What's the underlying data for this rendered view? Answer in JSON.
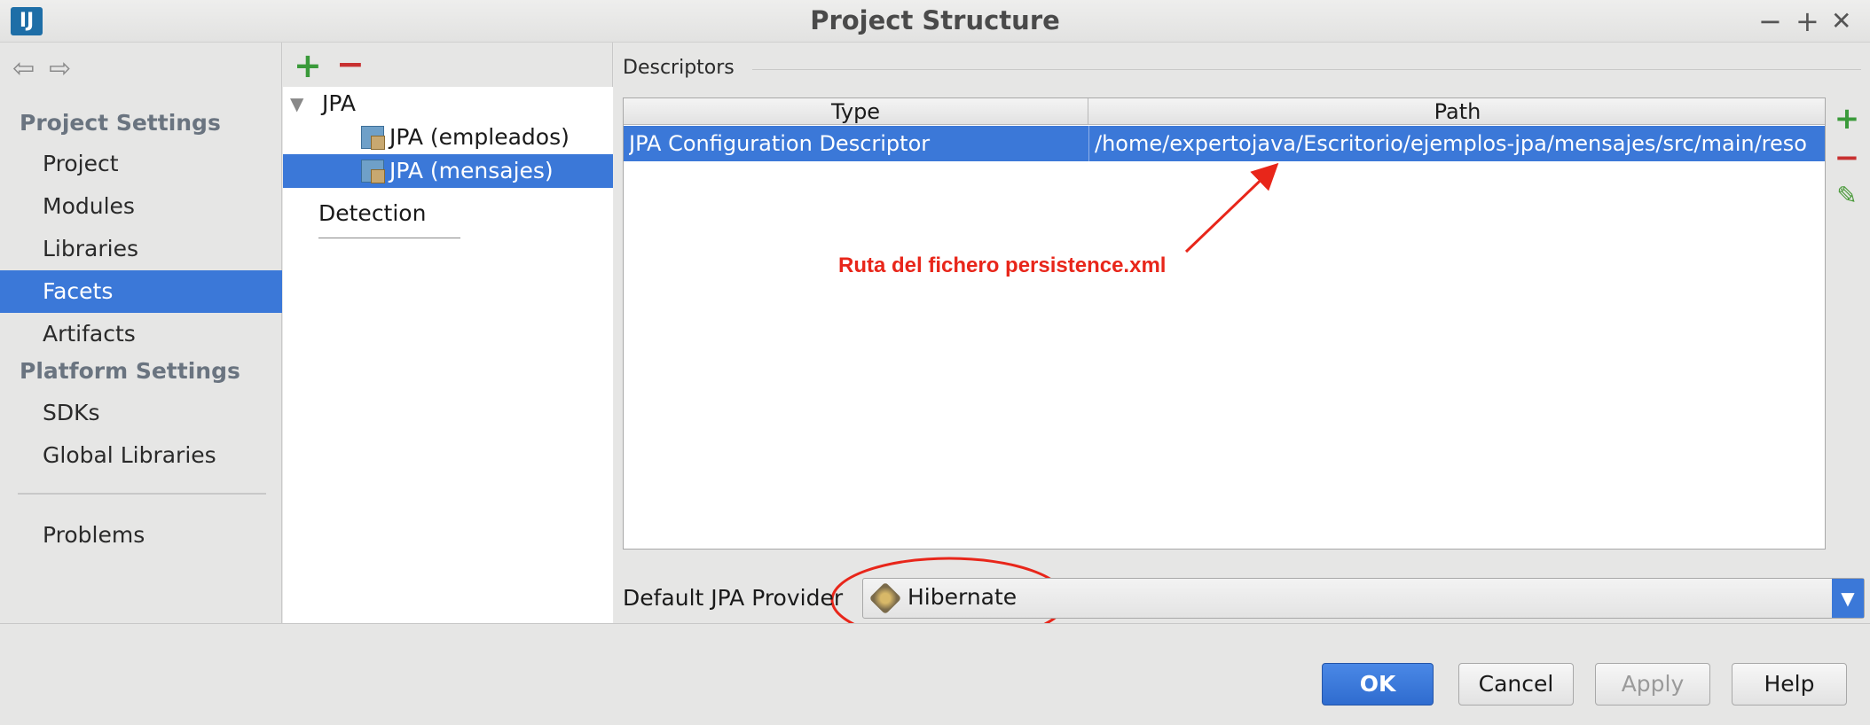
{
  "window": {
    "title": "Project Structure",
    "logo": "IJ",
    "minimize": "−",
    "maximize": "+",
    "close": "✕"
  },
  "nav": {
    "back": "⇦",
    "forward": "⇨",
    "project_settings_heading": "Project Settings",
    "project_items": [
      "Project",
      "Modules",
      "Libraries",
      "Facets",
      "Artifacts"
    ],
    "platform_settings_heading": "Platform Settings",
    "platform_items": [
      "SDKs",
      "Global Libraries"
    ],
    "problems": "Problems",
    "selected": "Facets"
  },
  "tree": {
    "add": "+",
    "remove": "−",
    "root": "JPA",
    "children": [
      "JPA (empleados)",
      "JPA (mensajes)"
    ],
    "selected": "JPA (mensajes)",
    "detection": "Detection"
  },
  "descriptors": {
    "label": "Descriptors",
    "columns": [
      "Type",
      "Path"
    ],
    "rows": [
      {
        "type": "JPA Configuration Descriptor",
        "path": "/home/expertojava/Escritorio/ejemplos-jpa/mensajes/src/main/reso"
      }
    ],
    "tools": {
      "add": "+",
      "remove": "−",
      "edit": "✎"
    }
  },
  "annotation": {
    "text": "Ruta del fichero persistence.xml",
    "color": "#e8261a"
  },
  "provider": {
    "label": "Default JPA Provider",
    "value": "Hibernate"
  },
  "buttons": {
    "ok": "OK",
    "cancel": "Cancel",
    "apply": "Apply",
    "help": "Help"
  },
  "colors": {
    "selection": "#3b78d8",
    "add_green": "#3a9a3a",
    "remove_red": "#c83030"
  }
}
